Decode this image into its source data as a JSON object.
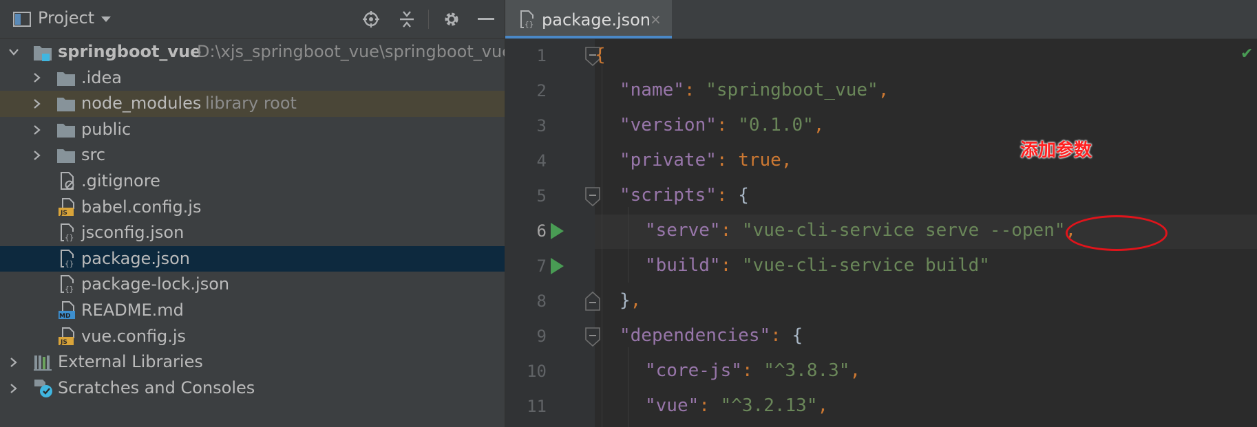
{
  "project_panel": {
    "title": "Project",
    "header_icons": [
      "locate-icon",
      "collapse-all-icon",
      "gear-icon",
      "minimize-icon"
    ],
    "tree": [
      {
        "label": "springboot_vue",
        "hint": "D:\\xjs_springboot_vue\\springboot_vue",
        "type": "project-folder",
        "expanded": true,
        "bold": true
      },
      {
        "label": ".idea",
        "type": "folder",
        "expanded": false
      },
      {
        "label": "node_modules",
        "hint": "library root",
        "type": "folder",
        "expanded": false
      },
      {
        "label": "public",
        "type": "folder",
        "expanded": false
      },
      {
        "label": "src",
        "type": "folder",
        "expanded": false
      },
      {
        "label": ".gitignore",
        "type": "gitignore-file"
      },
      {
        "label": "babel.config.js",
        "type": "js-file"
      },
      {
        "label": "jsconfig.json",
        "type": "json-file"
      },
      {
        "label": "package.json",
        "type": "json-file",
        "selected": true
      },
      {
        "label": "package-lock.json",
        "type": "json-file"
      },
      {
        "label": "README.md",
        "type": "md-file"
      },
      {
        "label": "vue.config.js",
        "type": "js-file"
      },
      {
        "label": "External Libraries",
        "type": "libraries",
        "expanded": false
      },
      {
        "label": "Scratches and Consoles",
        "type": "scratches",
        "expanded": false
      }
    ]
  },
  "editor": {
    "tab": {
      "label": "package.json",
      "close": "×"
    },
    "line_numbers": [
      "1",
      "2",
      "3",
      "4",
      "5",
      "6",
      "7",
      "8",
      "9",
      "10",
      "11"
    ],
    "current_line": "6",
    "code": {
      "l1": {
        "brace": "{"
      },
      "l2": {
        "key": "\"name\"",
        "colon": ": ",
        "value": "\"springboot_vue\"",
        "comma": ","
      },
      "l3": {
        "key": "\"version\"",
        "colon": ": ",
        "value": "\"0.1.0\"",
        "comma": ","
      },
      "l4": {
        "key": "\"private\"",
        "colon": ": ",
        "value": "true",
        "comma": ","
      },
      "l5": {
        "key": "\"scripts\"",
        "colon": ": ",
        "brace": "{"
      },
      "l6": {
        "key": "\"serve\"",
        "colon": ": ",
        "value_a": "\"vue-cli-service serve ",
        "value_b": "--open",
        "value_c": "\"",
        "comma": ","
      },
      "l7": {
        "key": "\"build\"",
        "colon": ": ",
        "value": "\"vue-cli-service build\""
      },
      "l8": {
        "brace": "}",
        "comma": ","
      },
      "l9": {
        "key": "\"dependencies\"",
        "colon": ": ",
        "brace": "{"
      },
      "l10": {
        "key": "\"core-js\"",
        "colon": ": ",
        "value": "\"^3.8.3\"",
        "comma": ","
      },
      "l11": {
        "key": "\"vue\"",
        "colon": ": ",
        "value": "\"^3.2.13\"",
        "comma": ","
      }
    },
    "annotation": "添加参数",
    "status_check": "✔"
  },
  "colors": {
    "panel_bg": "#3c3f41",
    "editor_bg": "#2b2b2b",
    "selection": "#0d293e",
    "library_highlight": "#4a4637",
    "json_key": "#9876aa",
    "json_string": "#6a8759",
    "json_keyword": "#cc7832",
    "annotation_red": "#e0141b"
  }
}
